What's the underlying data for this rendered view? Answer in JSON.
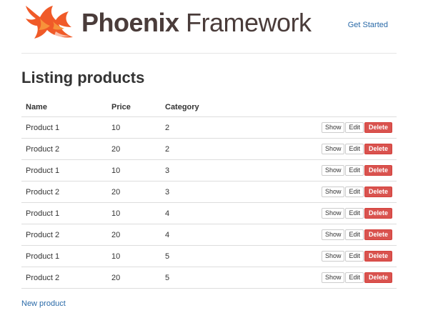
{
  "header": {
    "logo_bold": "Phoenix",
    "logo_light": " Framework",
    "nav_link": "Get Started"
  },
  "page": {
    "title": "Listing products"
  },
  "table": {
    "columns": [
      "Name",
      "Price",
      "Category"
    ],
    "rows": [
      {
        "name": "Product 1",
        "price": "10",
        "category": "2"
      },
      {
        "name": "Product 2",
        "price": "20",
        "category": "2"
      },
      {
        "name": "Product 1",
        "price": "10",
        "category": "3"
      },
      {
        "name": "Product 2",
        "price": "20",
        "category": "3"
      },
      {
        "name": "Product 1",
        "price": "10",
        "category": "4"
      },
      {
        "name": "Product 2",
        "price": "20",
        "category": "4"
      },
      {
        "name": "Product 1",
        "price": "10",
        "category": "5"
      },
      {
        "name": "Product 2",
        "price": "20",
        "category": "5"
      }
    ],
    "actions": {
      "show": "Show",
      "edit": "Edit",
      "delete": "Delete"
    }
  },
  "footer": {
    "new_link": "New product"
  },
  "colors": {
    "brand": "#f05a28",
    "link": "#2a6aa8",
    "danger": "#d9534f"
  }
}
